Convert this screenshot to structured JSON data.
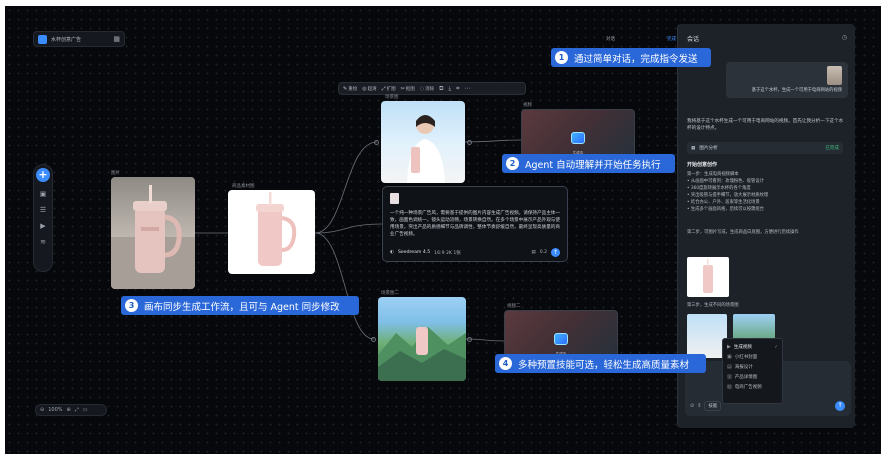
{
  "project": {
    "name": "水杯创意广告",
    "logo_icon": "logo-icon",
    "grid_icon": "grid-icon"
  },
  "toolbar": {
    "items": [
      {
        "label": "重绘",
        "icon": "redraw-icon"
      },
      {
        "label": "超清",
        "icon": "hd-icon"
      },
      {
        "label": "扩图",
        "icon": "expand-icon"
      },
      {
        "label": "抠图",
        "icon": "cutout-icon"
      },
      {
        "label": "消除",
        "icon": "erase-icon"
      }
    ],
    "actions": [
      "copy-icon",
      "download-icon",
      "crop-icon",
      "more-icon"
    ]
  },
  "left_tools": [
    "add-icon",
    "image-icon",
    "text-icon",
    "video-icon",
    "layers-icon"
  ],
  "zoom": {
    "value": "100%"
  },
  "nodes": {
    "photo_label": "图片",
    "white_label": "商品素材图",
    "woman_label": "场景图",
    "video1_label": "视频",
    "video1_caption": "生成中",
    "mountain_label": "场景图二",
    "video2_label": "视频二",
    "video2_caption": "生成中"
  },
  "textnode": {
    "body": "一个纯一种场景广告风，需要基于提供的图片内容生成广告视频。请保持产品主体一致，画面色调统一，镜头运动流畅，场景转换自然。在多个场景中展示产品外观与使用场景，突出产品的质感细节与品牌调性，整体节奏舒缓自然，最终呈现高质量的商业广告视频。",
    "model": "Seedream 4.5",
    "params": "16:9 2K 1张",
    "count": "0.2"
  },
  "callouts": [
    {
      "num": "1",
      "text": "通过简单对话，完成指令发送"
    },
    {
      "num": "2",
      "text": "Agent 自动理解并开始任务执行"
    },
    {
      "num": "3",
      "text": "画布同步生成工作流，且可与 Agent 同步修改"
    },
    {
      "num": "4",
      "text": "多种预置技能可选，轻松生成高质量素材"
    }
  ],
  "topright": {
    "left": "对话",
    "right": "完成"
  },
  "panel": {
    "title": "会话",
    "user_message": "基于这个水杯，生成一个可用于电商网站的视频",
    "reply": "我将基于这个水杯生成一个可用于电商网站的视频。首先让我分析一下这个水杯的设计特点。",
    "analysis_label": "图片分析",
    "analysis_status": "已完成",
    "section_title": "开始创意创作",
    "bullets": [
      "第一步：生成电商视频脚本",
      "• 从画面中可看到：玫瑰粉色、吸管设计",
      "• 360度旋转展示水杯的各个角度",
      "• 突出吸管与提手细节，放大展示材质纹理",
      "• 结合办公、户外、居家等生活化场景",
      "• 生成多个画面风格，后续可以按需组合"
    ],
    "step2": "第二步，可图片写成，生成商品白底图，方便进行后续操作",
    "step3": "第三步，生成不同的场景图",
    "step4": "第四步，等待场景图生成完成"
  },
  "dropdown": [
    {
      "label": "生成视频",
      "icon": "video-icon",
      "selected": true
    },
    {
      "label": "小红书封面",
      "icon": "image-icon",
      "selected": false
    },
    {
      "label": "海报设计",
      "icon": "poster-icon",
      "selected": false
    },
    {
      "label": "产品详情图",
      "icon": "detail-icon",
      "selected": false
    },
    {
      "label": "电商广告视频",
      "icon": "ad-icon",
      "selected": false
    }
  ],
  "input": {
    "placeholder": "",
    "skill_label": "技能"
  },
  "colors": {
    "accent": "#3b8cff",
    "callout": "#2a67d8",
    "canvas": "#07080b",
    "panel": "#1d2228"
  }
}
